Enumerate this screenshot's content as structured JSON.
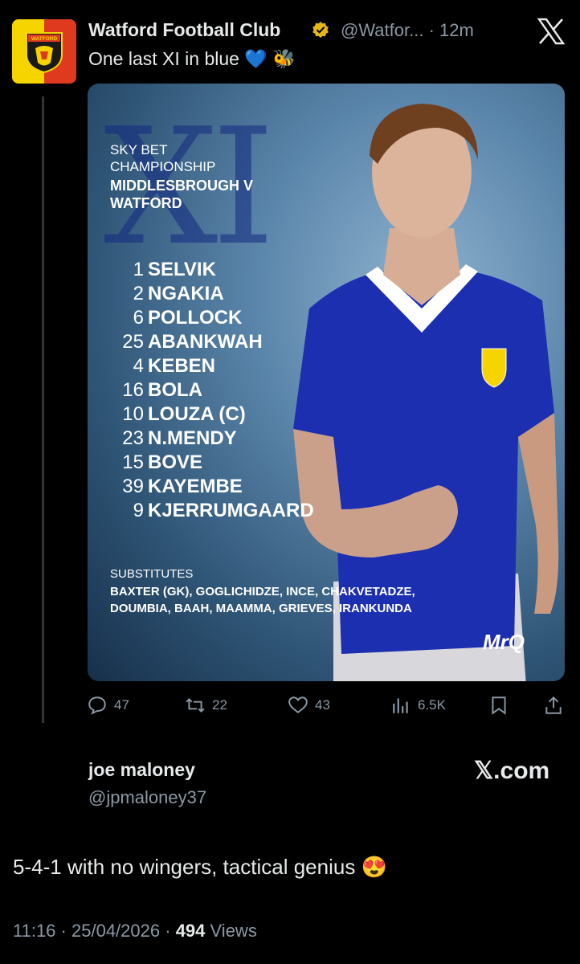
{
  "tweet": {
    "author_name": "Watford Football Club",
    "handle": "@Watfor...",
    "separator": "·",
    "time": "12m",
    "text": "One last XI in blue 💙 🐝",
    "avatar_text": "WATFORD",
    "verified": true
  },
  "graphic": {
    "competition_line1": "SKY BET",
    "competition_line2": "CHAMPIONSHIP",
    "match_line1": "MIDDLESBROUGH V",
    "match_line2": "WATFORD",
    "lineup": [
      {
        "number": "1",
        "name": "SELVIK"
      },
      {
        "number": "2",
        "name": "NGAKIA"
      },
      {
        "number": "6",
        "name": "POLLOCK"
      },
      {
        "number": "25",
        "name": "ABANKWAH"
      },
      {
        "number": "4",
        "name": "KEBEN"
      },
      {
        "number": "16",
        "name": "BOLA"
      },
      {
        "number": "10",
        "name": "LOUZA (C)"
      },
      {
        "number": "23",
        "name": "N.MENDY"
      },
      {
        "number": "15",
        "name": "BOVE"
      },
      {
        "number": "39",
        "name": "KAYEMBE"
      },
      {
        "number": "9",
        "name": "KJERRUMGAARD"
      }
    ],
    "substitutes_heading": "SUBSTITUTES",
    "substitutes_text": "BAXTER (GK), GOGLICHIDZE, INCE, CHAKVETADZE, DOUMBIA, BAAH, MAAMMA, GRIEVES, IRANKUNDA",
    "sponsor": "MrQ"
  },
  "actions": {
    "replies": "47",
    "reposts": "22",
    "likes": "43",
    "views": "6.5K"
  },
  "quoter": {
    "name": "joe maloney",
    "handle": "@jpmaloney37",
    "watermark": "𝕏.com"
  },
  "reply": {
    "text": "5-4-1 with no wingers, tactical genius 😍"
  },
  "meta": {
    "time": "11:16",
    "date": "25/04/2026",
    "views_count": "494",
    "views_label": "Views"
  },
  "colors": {
    "background": "#000000",
    "text_primary": "#e7e9ea",
    "text_secondary": "#8b98a5",
    "kit_blue": "#1c2fb0",
    "verified_gold": "#e2b719"
  }
}
